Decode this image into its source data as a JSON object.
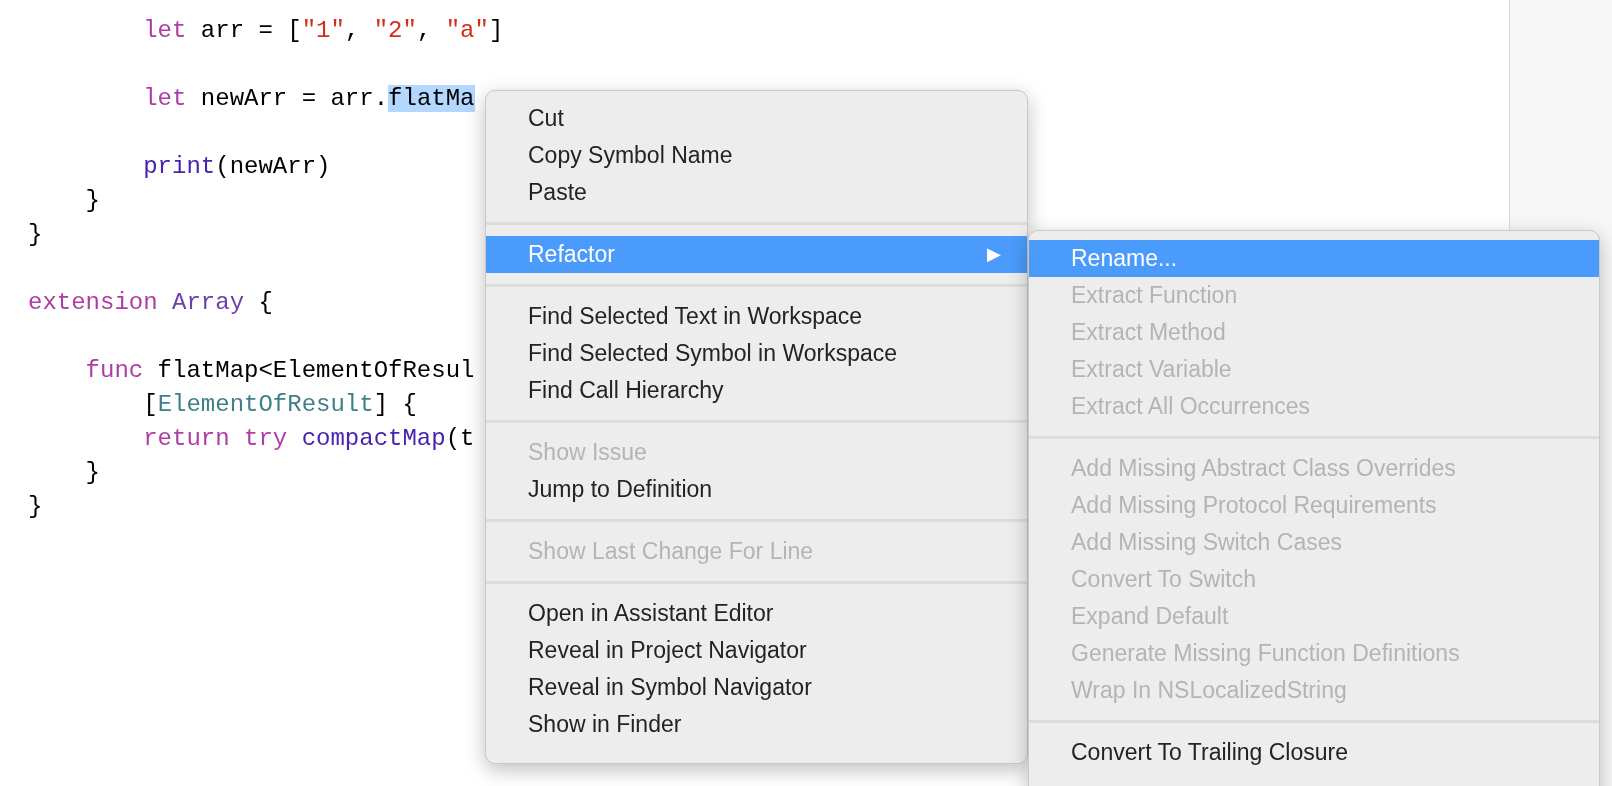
{
  "editor": {
    "blocks": [
      [
        [
          {
            "text": "        let",
            "kind": "keyword"
          },
          {
            "text": " arr = [",
            "kind": "plain"
          },
          {
            "text": "\"1\"",
            "kind": "string"
          },
          {
            "text": ", ",
            "kind": "plain"
          },
          {
            "text": "\"2\"",
            "kind": "string"
          },
          {
            "text": ", ",
            "kind": "plain"
          },
          {
            "text": "\"a\"",
            "kind": "string"
          },
          {
            "text": "]",
            "kind": "plain"
          }
        ]
      ],
      [
        [
          {
            "text": "        let",
            "kind": "keyword"
          },
          {
            "text": " newArr = arr.",
            "kind": "plain"
          },
          {
            "text": "flatMa",
            "kind": "selection"
          }
        ]
      ],
      [
        [
          {
            "text": "        print",
            "kind": "function"
          },
          {
            "text": "(newArr)",
            "kind": "plain"
          }
        ],
        [
          {
            "text": "    }",
            "kind": "plain"
          }
        ],
        [
          {
            "text": "}",
            "kind": "plain"
          }
        ]
      ],
      [
        [
          {
            "text": "extension",
            "kind": "keyword"
          },
          {
            "text": " Array",
            "kind": "class"
          },
          {
            "text": " {",
            "kind": "plain"
          }
        ]
      ],
      [
        [
          {
            "text": "    func",
            "kind": "keyword"
          },
          {
            "text": " flatMap<ElementOfResul",
            "kind": "plain"
          }
        ],
        [
          {
            "text": "        [",
            "kind": "plain"
          },
          {
            "text": "ElementOfResult",
            "kind": "type"
          },
          {
            "text": "] {",
            "kind": "plain"
          }
        ],
        [
          {
            "text": "        return",
            "kind": "keyword"
          },
          {
            "text": " try",
            "kind": "keyword"
          },
          {
            "text": " compactMap",
            "kind": "function"
          },
          {
            "text": "(t",
            "kind": "plain"
          }
        ],
        [
          {
            "text": "    }",
            "kind": "plain"
          }
        ],
        [
          {
            "text": "}",
            "kind": "plain"
          }
        ]
      ]
    ]
  },
  "context_menu": {
    "groups": [
      [
        {
          "label": "Cut",
          "disabled": false,
          "selected": false
        },
        {
          "label": "Copy Symbol Name",
          "disabled": false,
          "selected": false
        },
        {
          "label": "Paste",
          "disabled": false,
          "selected": false
        }
      ],
      [
        {
          "label": "Refactor",
          "disabled": false,
          "selected": true,
          "submenu_arrow": "▶"
        }
      ],
      [
        {
          "label": "Find Selected Text in Workspace",
          "disabled": false,
          "selected": false
        },
        {
          "label": "Find Selected Symbol in Workspace",
          "disabled": false,
          "selected": false
        },
        {
          "label": "Find Call Hierarchy",
          "disabled": false,
          "selected": false
        }
      ],
      [
        {
          "label": "Show Issue",
          "disabled": true,
          "selected": false
        },
        {
          "label": "Jump to Definition",
          "disabled": false,
          "selected": false
        }
      ],
      [
        {
          "label": "Show Last Change For Line",
          "disabled": true,
          "selected": false
        }
      ],
      [
        {
          "label": "Open in Assistant Editor",
          "disabled": false,
          "selected": false
        },
        {
          "label": "Reveal in Project Navigator",
          "disabled": false,
          "selected": false
        },
        {
          "label": "Reveal in Symbol Navigator",
          "disabled": false,
          "selected": false
        },
        {
          "label": "Show in Finder",
          "disabled": false,
          "selected": false
        }
      ]
    ]
  },
  "submenu": {
    "groups": [
      [
        {
          "label": "Rename...",
          "disabled": false,
          "selected": true
        },
        {
          "label": "Extract Function",
          "disabled": true,
          "selected": false
        },
        {
          "label": "Extract Method",
          "disabled": true,
          "selected": false
        },
        {
          "label": "Extract Variable",
          "disabled": true,
          "selected": false
        },
        {
          "label": "Extract All Occurrences",
          "disabled": true,
          "selected": false
        }
      ],
      [
        {
          "label": "Add Missing Abstract Class Overrides",
          "disabled": true,
          "selected": false
        },
        {
          "label": "Add Missing Protocol Requirements",
          "disabled": true,
          "selected": false
        },
        {
          "label": "Add Missing Switch Cases",
          "disabled": true,
          "selected": false
        },
        {
          "label": "Convert To Switch",
          "disabled": true,
          "selected": false
        },
        {
          "label": "Expand Default",
          "disabled": true,
          "selected": false
        },
        {
          "label": "Generate Missing Function Definitions",
          "disabled": true,
          "selected": false
        },
        {
          "label": "Wrap In NSLocalizedString",
          "disabled": true,
          "selected": false
        }
      ],
      [
        {
          "label": "Convert To Trailing Closure",
          "disabled": false,
          "selected": false
        }
      ]
    ]
  }
}
